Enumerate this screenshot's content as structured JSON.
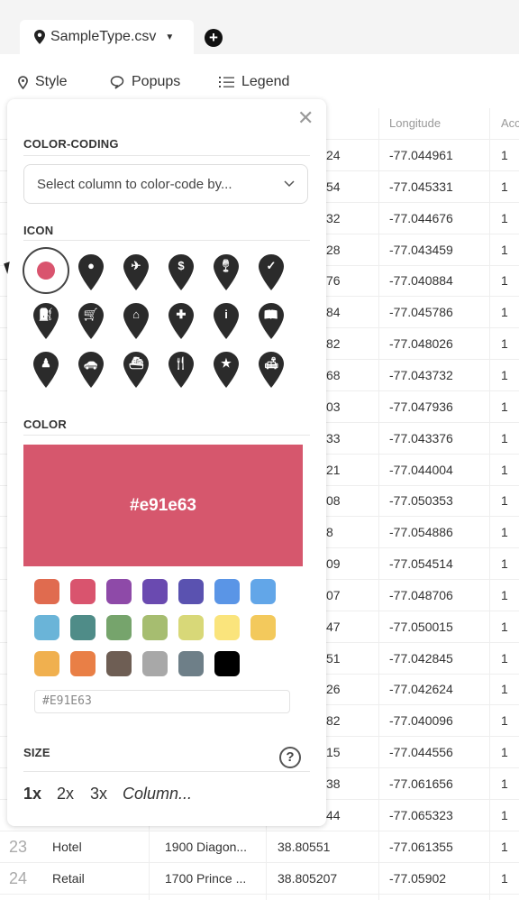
{
  "tab": {
    "file_name": "SampleType.csv"
  },
  "toolbar": {
    "style": "Style",
    "popups": "Popups",
    "legend": "Legend"
  },
  "table": {
    "headers": {
      "longitude": "Longitude",
      "accuracy": "Acc"
    },
    "partial_rows": [
      {
        "lat_tail": "24",
        "longitude": "-77.044961",
        "acc": "1"
      },
      {
        "lat_tail": "54",
        "longitude": "-77.045331",
        "acc": "1"
      },
      {
        "lat_tail": "32",
        "longitude": "-77.044676",
        "acc": "1"
      },
      {
        "lat_tail": "28",
        "longitude": "-77.043459",
        "acc": "1"
      },
      {
        "lat_tail": "76",
        "longitude": "-77.040884",
        "acc": "1"
      },
      {
        "lat_tail": "84",
        "longitude": "-77.045786",
        "acc": "1"
      },
      {
        "lat_tail": "82",
        "longitude": "-77.048026",
        "acc": "1"
      },
      {
        "lat_tail": "68",
        "longitude": "-77.043732",
        "acc": "1"
      },
      {
        "lat_tail": "03",
        "longitude": "-77.047936",
        "acc": "1"
      },
      {
        "lat_tail": "33",
        "longitude": "-77.043376",
        "acc": "1"
      },
      {
        "lat_tail": "21",
        "longitude": "-77.044004",
        "acc": "1"
      },
      {
        "lat_tail": "08",
        "longitude": "-77.050353",
        "acc": "1"
      },
      {
        "lat_tail": "8",
        "longitude": "-77.054886",
        "acc": "1"
      },
      {
        "lat_tail": "09",
        "longitude": "-77.054514",
        "acc": "1"
      },
      {
        "lat_tail": "07",
        "longitude": "-77.048706",
        "acc": "1"
      },
      {
        "lat_tail": "47",
        "longitude": "-77.050015",
        "acc": "1"
      },
      {
        "lat_tail": "51",
        "longitude": "-77.042845",
        "acc": "1"
      },
      {
        "lat_tail": "26",
        "longitude": "-77.042624",
        "acc": "1"
      },
      {
        "lat_tail": "82",
        "longitude": "-77.040096",
        "acc": "1"
      },
      {
        "lat_tail": "15",
        "longitude": "-77.044556",
        "acc": "1"
      },
      {
        "lat_tail": "38",
        "longitude": "-77.061656",
        "acc": "1"
      },
      {
        "lat_tail": "44",
        "longitude": "-77.065323",
        "acc": "1"
      }
    ],
    "full_rows": [
      {
        "num": "23",
        "type": "Hotel",
        "address": "1900 Diagon...",
        "latitude": "38.80551",
        "longitude": "-77.061355",
        "acc": "1"
      },
      {
        "num": "24",
        "type": "Retail",
        "address": "1700 Prince ...",
        "latitude": "38.805207",
        "longitude": "-77.05902",
        "acc": "1"
      }
    ]
  },
  "panel": {
    "color_coding_label": "COLOR-CODING",
    "select_placeholder": "Select column to color-code by...",
    "icon_label": "ICON",
    "icons": [
      "dot",
      "circle",
      "airplane",
      "dollar",
      "wine-glass",
      "check",
      "gas-station",
      "cart",
      "home",
      "plus",
      "info",
      "book",
      "chess-pawn",
      "car",
      "ship",
      "restaurant",
      "star",
      "bench"
    ],
    "selected_icon": "dot",
    "color_label": "COLOR",
    "selected_color": "#e91e63",
    "selected_color_display": "#e91e63",
    "hex_input": "#E91E63",
    "swatches": [
      "#e06b4f",
      "#d9546e",
      "#8e4aa8",
      "#6a4ab0",
      "#5a52b0",
      "#5a95e6",
      "#62a6e8",
      "#6ab4d8",
      "#4f8c88",
      "#76a46c",
      "#a6bd70",
      "#d8d878",
      "#fae47c",
      "#f3c95c",
      "#f0b04f",
      "#e97f46",
      "#6e5e54",
      "#a8a8a8",
      "#6e7f88",
      "#000000"
    ],
    "size_label": "SIZE",
    "help": "?",
    "sizes": [
      "1x",
      "2x",
      "3x",
      "Column..."
    ],
    "selected_size": "1x"
  }
}
